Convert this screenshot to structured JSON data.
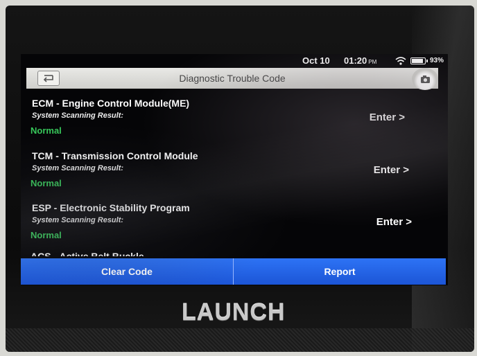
{
  "status_bar": {
    "date": "Oct 10",
    "time": "01:20",
    "ampm": "PM",
    "battery_percent": "93%",
    "battery_level": 0.93
  },
  "header": {
    "title": "Diagnostic Trouble Code",
    "back_icon": "back-arrow-icon",
    "camera_icon": "camera-icon"
  },
  "modules": [
    {
      "name": "ECM - Engine Control Module(ME)",
      "result_label": "System Scanning Result:",
      "status": "Normal",
      "enter_label": "Enter >"
    },
    {
      "name": "TCM - Transmission Control Module",
      "result_label": "System Scanning Result:",
      "status": "Normal",
      "enter_label": "Enter >"
    },
    {
      "name": "ESP - Electronic Stability Program",
      "result_label": "System Scanning Result:",
      "status": "Normal",
      "enter_label": "Enter >"
    }
  ],
  "partial_module": "ACS - Active Belt Buckle",
  "actions": {
    "clear_code": "Clear Code",
    "report": "Report"
  },
  "brand": "LAUNCH",
  "colors": {
    "status_normal": "#37c85a",
    "button_blue": "#1f5fe6",
    "title_bar": "#dcdcd8"
  }
}
